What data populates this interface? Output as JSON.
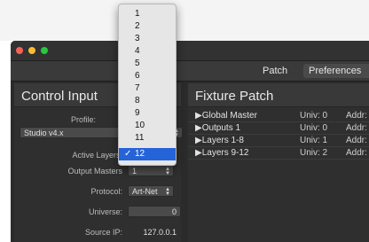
{
  "window": {
    "tabs": [
      {
        "label": "Patch"
      },
      {
        "label": "Preferences"
      }
    ]
  },
  "control_input": {
    "title": "Control Input",
    "profile": {
      "label": "Profile:",
      "value": "Studio v4.x"
    },
    "active_layers": {
      "label": "Active Layers:"
    },
    "output_masters": {
      "label": "Output Masters",
      "value": "1"
    },
    "protocol": {
      "label": "Protocol:",
      "value": "Art-Net"
    },
    "universe": {
      "label": "Universe:",
      "value": "0"
    },
    "source_ip": {
      "label": "Source IP:",
      "value": "127.0.0.1"
    }
  },
  "fixture_patch": {
    "title": "Fixture Patch",
    "rows": [
      {
        "name": "▶Global Master",
        "univ": "Univ: 0",
        "addr": "Addr:"
      },
      {
        "name": "▶Outputs 1",
        "univ": "Univ: 0",
        "addr": "Addr:"
      },
      {
        "name": "▶Layers 1-8",
        "univ": "Univ: 1",
        "addr": "Addr:"
      },
      {
        "name": "▶Layers 9-12",
        "univ": "Univ: 2",
        "addr": "Addr:"
      }
    ]
  },
  "dropdown": {
    "options": [
      "1",
      "2",
      "3",
      "4",
      "5",
      "6",
      "7",
      "8",
      "9",
      "10",
      "11",
      "12"
    ],
    "selected": "12",
    "check": "✓"
  },
  "colors": {
    "selection": "#2563d9",
    "window_bg": "#2b2b2b"
  }
}
